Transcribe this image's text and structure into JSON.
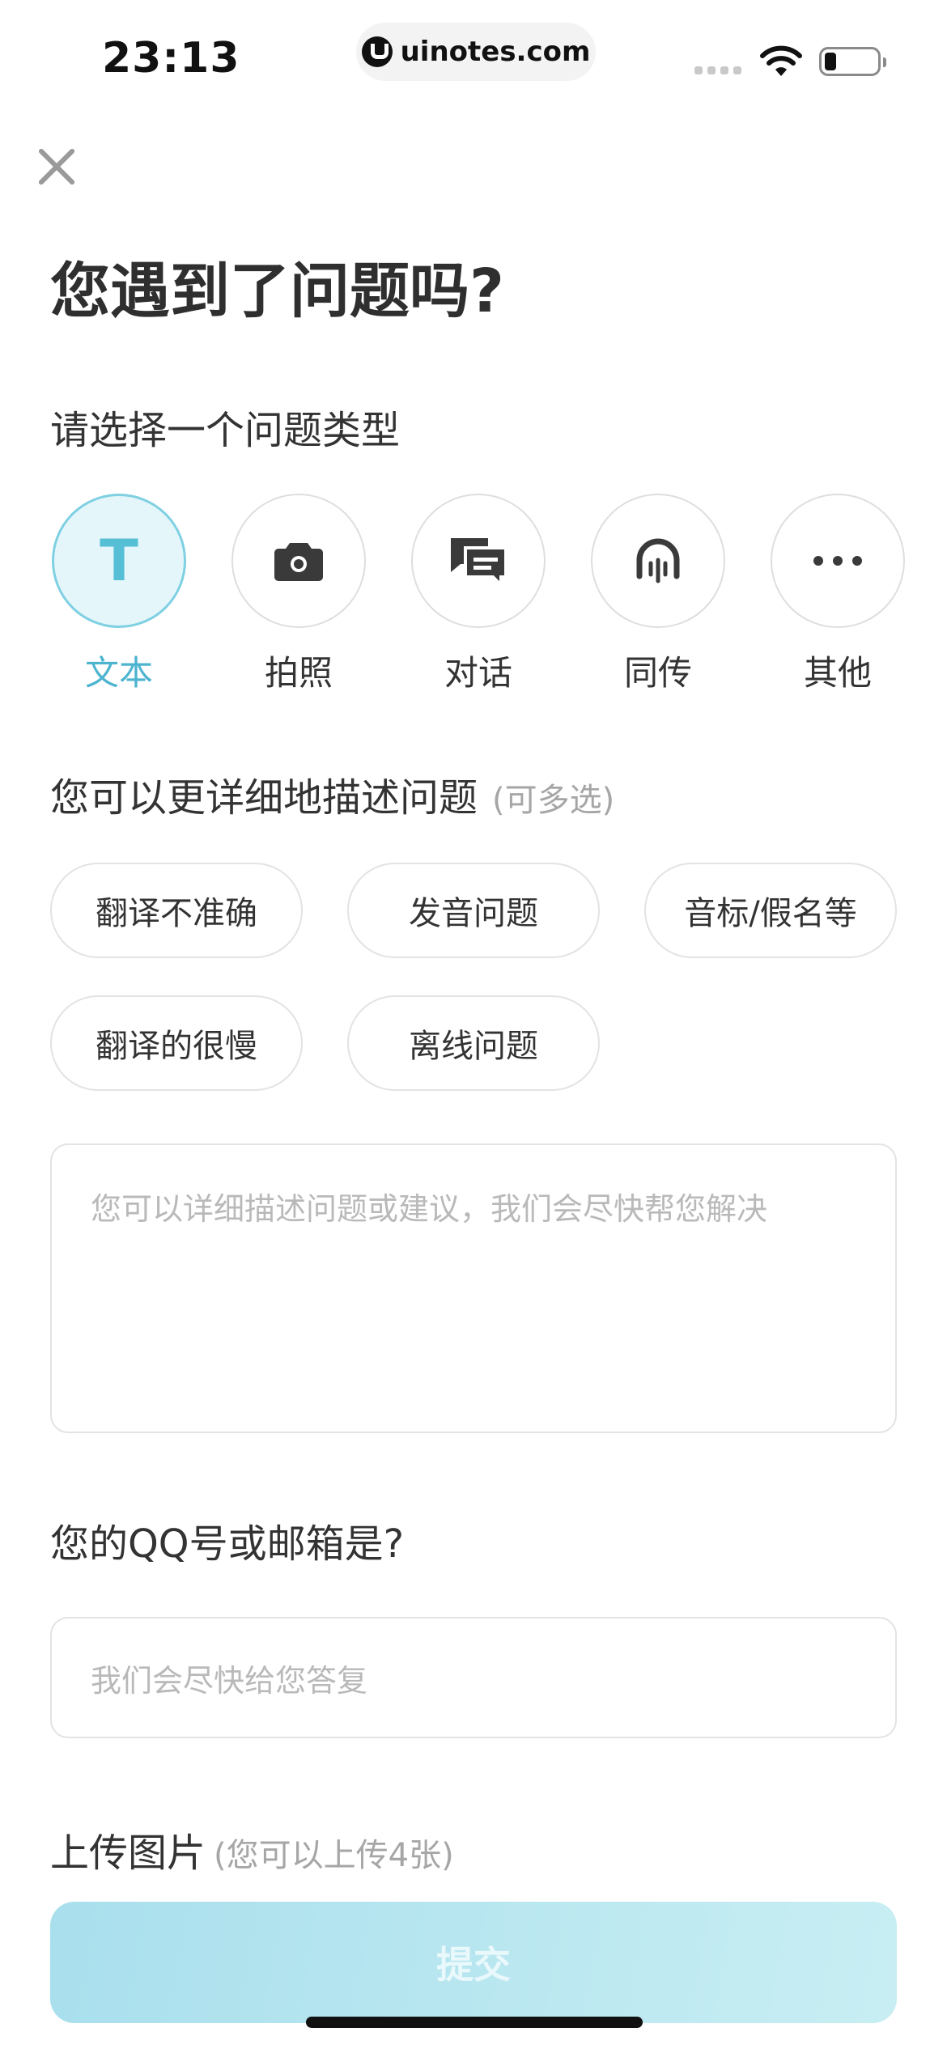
{
  "status_bar": {
    "time": "23:13",
    "url": "uinotes.com"
  },
  "header": {
    "title": "您遇到了问题吗?"
  },
  "type_section": {
    "label": "请选择一个问题类型",
    "types": [
      {
        "label": "文本",
        "icon": "text-t-icon",
        "selected": true
      },
      {
        "label": "拍照",
        "icon": "camera-icon",
        "selected": false
      },
      {
        "label": "对话",
        "icon": "conversation-icon",
        "selected": false
      },
      {
        "label": "同传",
        "icon": "simultaneous-interpretation-icon",
        "selected": false
      },
      {
        "label": "其他",
        "icon": "more-dots-icon",
        "selected": false
      }
    ],
    "accent_color": "#56bfd6"
  },
  "detail_section": {
    "label": "您可以更详细地描述问题",
    "hint": "(可多选)",
    "chips": [
      "翻译不准确",
      "发音问题",
      "音标/假名等",
      "翻译的很慢",
      "离线问题"
    ]
  },
  "description": {
    "placeholder": "您可以详细描述问题或建议，我们会尽快帮您解决"
  },
  "contact_section": {
    "label": "您的QQ号或邮箱是?",
    "placeholder": "我们会尽快给您答复"
  },
  "upload_section": {
    "label": "上传图片",
    "hint": "(您可以上传4张)"
  },
  "submit": {
    "label": "提交"
  }
}
